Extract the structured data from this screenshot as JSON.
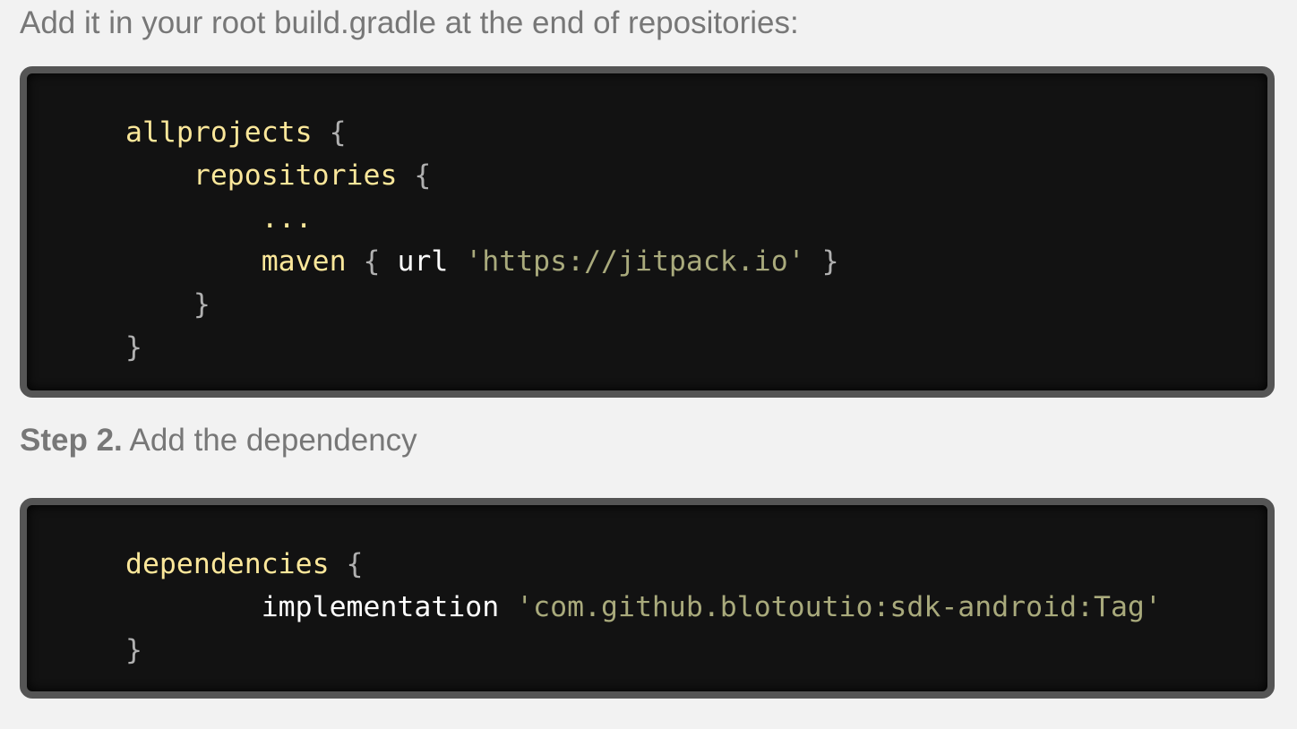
{
  "intro_text": "Add it in your root build.gradle at the end of repositories:",
  "step2": {
    "label": "Step 2.",
    "text": " Add the dependency"
  },
  "code1": {
    "allprojects": "allprojects",
    "repositories": "repositories",
    "ellipsis": "...",
    "maven": "maven",
    "url": "url",
    "url_value": "'https://jitpack.io'",
    "open_brace": "{",
    "close_brace": "}"
  },
  "code2": {
    "dependencies": "dependencies",
    "implementation": "implementation",
    "artifact": "'com.github.blotoutio:sdk-android:Tag'",
    "open_brace": "{",
    "close_brace": "}"
  },
  "colors": {
    "keyword": "#fbe79a",
    "string": "#a9aa7c",
    "brace": "#b0b0b0",
    "code_bg": "#121212",
    "border": "#555555"
  }
}
